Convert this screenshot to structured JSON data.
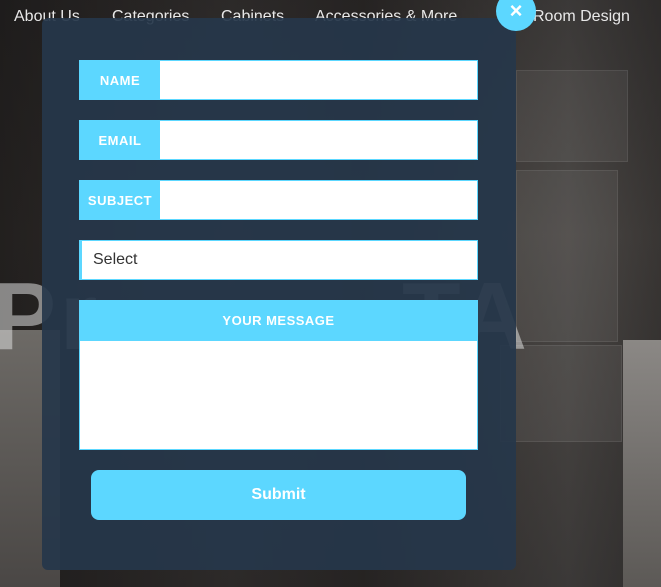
{
  "nav": {
    "items": [
      "About Us",
      "Categories",
      "Cabinets",
      "Accessories & More",
      "Room Design"
    ]
  },
  "hero": {
    "left": "Pr",
    "right": "TA"
  },
  "modal": {
    "close_icon": "×",
    "fields": [
      {
        "label": "NAME",
        "value": ""
      },
      {
        "label": "EMAIL",
        "value": ""
      },
      {
        "label": "SUBJECT",
        "value": ""
      }
    ],
    "select": {
      "value": "Select"
    },
    "message": {
      "label": "YOUR MESSAGE",
      "value": ""
    },
    "submit_label": "Submit"
  },
  "colors": {
    "accent": "#5cd7ff",
    "modal_bg": "#26374a"
  }
}
